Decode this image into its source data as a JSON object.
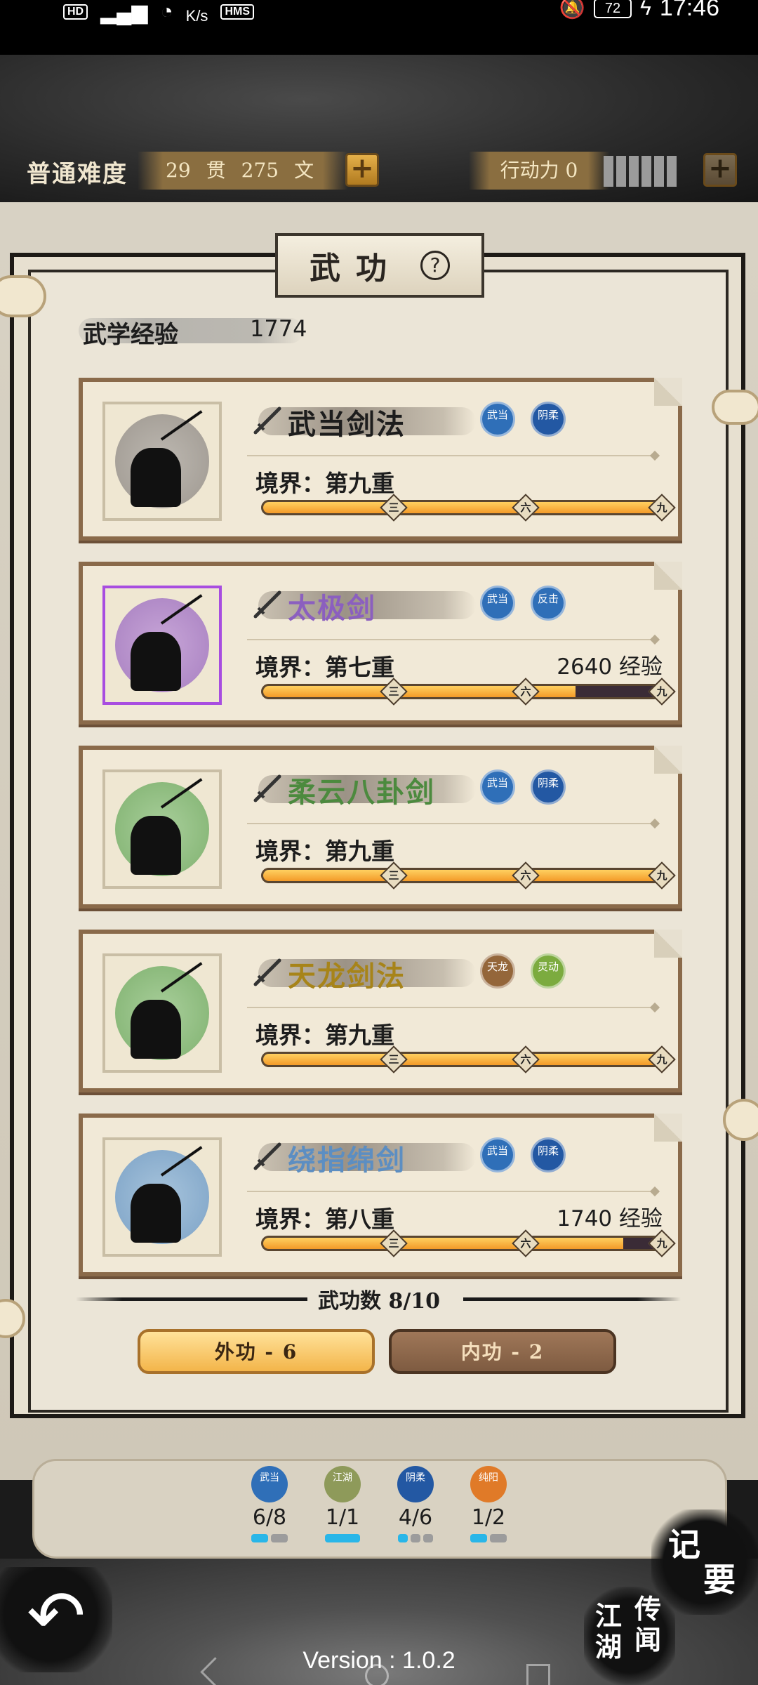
{
  "status_bar": {
    "hd": "HD",
    "speed_unit": "K/s",
    "hms": "HMS",
    "battery": "72",
    "time": "17:46"
  },
  "top": {
    "difficulty": "普通难度",
    "money_guan": "29",
    "money_guan_unit": "贯",
    "money_wen": "275",
    "money_wen_unit": "文",
    "plus": "+",
    "action_label": "行动力 0"
  },
  "panel": {
    "title": "武功",
    "help": "?",
    "exp_label": "武学经验",
    "exp_value": "1774"
  },
  "skills": [
    {
      "name": "武当剑法",
      "realm": "境界：第九重",
      "exp": "",
      "progress": 1.0,
      "tags": [
        {
          "text": "武当"
        },
        {
          "text": "阴柔"
        }
      ]
    },
    {
      "name": "太极剑",
      "realm": "境界：第七重",
      "exp": "2640 经验",
      "progress": 0.78,
      "tags": [
        {
          "text": "武当"
        },
        {
          "text": "反击"
        }
      ]
    },
    {
      "name": "柔云八卦剑",
      "realm": "境界：第九重",
      "exp": "",
      "progress": 1.0,
      "tags": [
        {
          "text": "武当"
        },
        {
          "text": "阴柔"
        }
      ]
    },
    {
      "name": "天龙剑法",
      "realm": "境界：第九重",
      "exp": "",
      "progress": 1.0,
      "tags": [
        {
          "text": "天龙"
        },
        {
          "text": "灵动"
        }
      ]
    },
    {
      "name": "绕指绵剑",
      "realm": "境界：第八重",
      "exp": "1740 经验",
      "progress": 0.9,
      "tags": [
        {
          "text": "武当"
        },
        {
          "text": "阴柔"
        }
      ]
    }
  ],
  "bar_marks": [
    "三",
    "六",
    "九"
  ],
  "count_label": "武功数 8/10",
  "tabs": {
    "outer": "外功 - 6",
    "inner": "内功 - 2"
  },
  "sects": [
    {
      "badge": "武当",
      "count": "6/8",
      "color": "#2f6fb8",
      "pips_on": 1,
      "pips_total": 2
    },
    {
      "badge": "江湖",
      "count": "1/1",
      "color": "#8e9a5a",
      "pips_on": 1,
      "pips_total": 1
    },
    {
      "badge": "阴柔",
      "count": "4/6",
      "color": "#2358a3",
      "pips_on": 1,
      "pips_total": 3
    },
    {
      "badge": "纯阳",
      "count": "1/2",
      "color": "#e07a28",
      "pips_on": 1,
      "pips_total": 2
    }
  ],
  "bottom": {
    "back_icon": "↶",
    "memo_1": "记",
    "memo_2": "要",
    "legend_1": "传闻",
    "legend_2": "江湖",
    "version": "Version : 1.0.2"
  }
}
